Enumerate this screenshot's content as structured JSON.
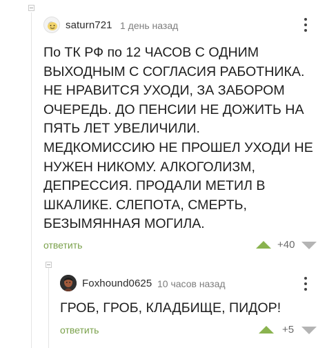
{
  "comments": [
    {
      "username": "saturn721",
      "time": "1 день назад",
      "avatar_icon": "smiley-avatar-icon",
      "text_lines": [
        "По ТК РФ по 12 ЧАСОВ С ОДНИМ",
        "ВЫХОДНЫМ С СОГЛАСИЯ РАБОТНИКА.",
        "НЕ НРАВИТСЯ УХОДИ, ЗА ЗАБОРОМ",
        "ОЧЕРЕДЬ. ДО ПЕНСИИ НЕ ДОЖИТЬ НА",
        "ПЯТЬ ЛЕТ УВЕЛИЧИЛИ.",
        "МЕДКОМИССИЮ НЕ ПРОШЕЛ УХОДИ НЕ",
        "НУЖЕН НИКОМУ. АЛКОГОЛИЗМ,",
        "ДЕПРЕССИЯ. ПРОДАЛИ МЕТИЛ В",
        "ШКАЛИКЕ. СЛЕПОТА, СМЕРТЬ,",
        "БЕЗЫМЯННАЯ МОГИЛА."
      ],
      "reply_label": "ответить",
      "rating": "+40"
    },
    {
      "username": "Foxhound0625",
      "time": "10 часов назад",
      "avatar_icon": "photo-avatar-icon",
      "text_lines": [
        "ГРОБ, ГРОБ, КЛАДБИЩЕ, ПИДОР!"
      ],
      "reply_label": "ответить",
      "rating": "+5"
    }
  ],
  "colors": {
    "accent_green": "#8ab34f",
    "reply_green": "#7aa14b",
    "muted_gray": "#7d7d7d"
  }
}
